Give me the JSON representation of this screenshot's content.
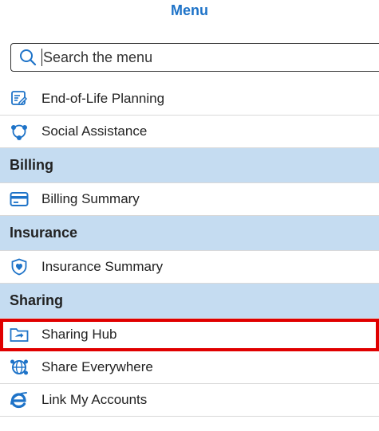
{
  "header": {
    "title": "Menu"
  },
  "search": {
    "placeholder": "Search the menu"
  },
  "menu": {
    "end_of_life": {
      "label": "End-of-Life Planning",
      "icon": "document-edit-icon"
    },
    "social_assistance": {
      "label": "Social Assistance",
      "icon": "network-nodes-icon"
    },
    "billing_section": {
      "label": "Billing"
    },
    "billing_summary": {
      "label": "Billing Summary",
      "icon": "credit-card-icon"
    },
    "insurance_section": {
      "label": "Insurance"
    },
    "insurance_summary": {
      "label": "Insurance Summary",
      "icon": "shield-heart-icon"
    },
    "sharing_section": {
      "label": "Sharing"
    },
    "sharing_hub": {
      "label": "Sharing Hub",
      "icon": "folder-share-icon"
    },
    "share_everywhere": {
      "label": "Share Everywhere",
      "icon": "globe-share-icon"
    },
    "link_accounts": {
      "label": "Link My Accounts",
      "icon": "link-e-icon"
    }
  },
  "colors": {
    "accent": "#1e73c8",
    "section_bg": "#c5dcf1",
    "highlight": "#e00000"
  }
}
